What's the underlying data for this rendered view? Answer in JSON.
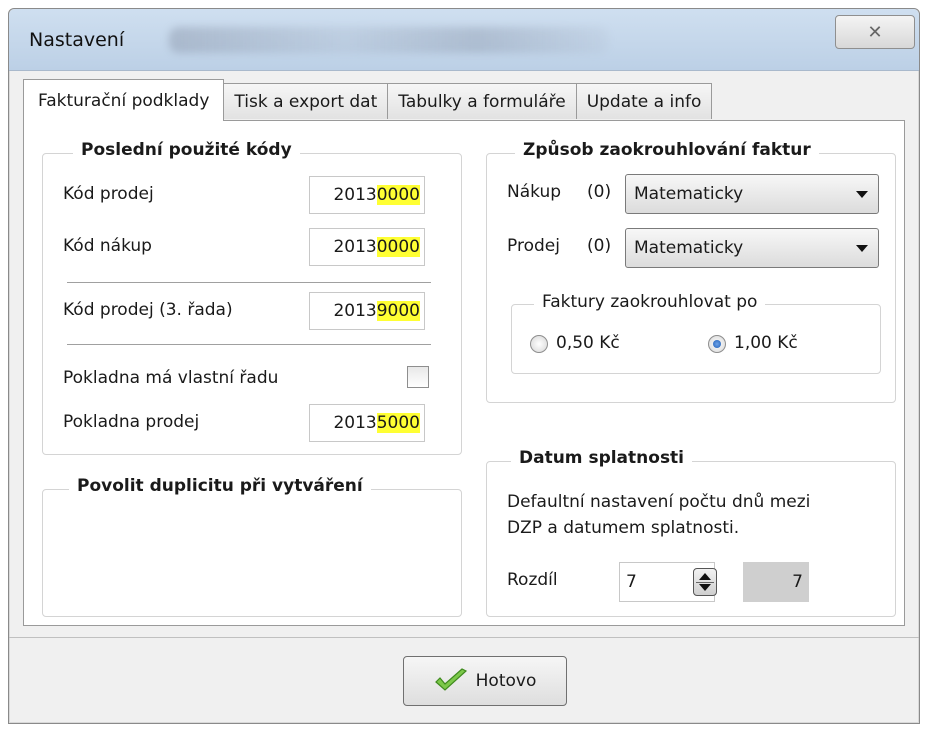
{
  "window": {
    "title": "Nastavení",
    "close_glyph": "✕"
  },
  "tabs": [
    {
      "label": "Fakturační podklady",
      "active": true
    },
    {
      "label": "Tisk a export dat",
      "active": false
    },
    {
      "label": "Tabulky a formuláře",
      "active": false
    },
    {
      "label": "Update a info",
      "active": false
    }
  ],
  "codes_group": {
    "title": "Poslední použité kódy",
    "rows": [
      {
        "label": "Kód prodej",
        "prefix": "2013",
        "highlight": "0000"
      },
      {
        "label": "Kód nákup",
        "prefix": "2013",
        "highlight": "0000"
      },
      {
        "label": "Kód prodej (3. řada)",
        "prefix": "2013",
        "highlight": "9000"
      }
    ],
    "pokladna_own_label": "Pokladna má vlastní řadu",
    "pokladna_own_checked": false,
    "pokladna_row": {
      "label": "Pokladna prodej",
      "prefix": "2013",
      "highlight": "5000"
    },
    "highlight_color": "#ffff33"
  },
  "duplicity_group": {
    "title": "Povolit duplicitu při vytváření"
  },
  "rounding_group": {
    "title": "Způsob zaokrouhlování faktur",
    "nakup": {
      "label": "Nákup",
      "code": "(0)",
      "value": "Matematicky"
    },
    "prodej": {
      "label": "Prodej",
      "code": "(0)",
      "value": "Matematicky"
    },
    "sub": {
      "title": "Faktury zaokrouhlovat po",
      "options": [
        {
          "label": "0,50 Kč",
          "checked": false
        },
        {
          "label": "1,00 Kč",
          "checked": true
        }
      ]
    }
  },
  "due_group": {
    "title": "Datum splatnosti",
    "description_line1": "Defaultní nastavení počtu dnů mezi",
    "description_line2": "DZP a datumem splatnosti.",
    "diff_label": "Rozdíl",
    "diff_value": "7",
    "computed_value": "7"
  },
  "footer": {
    "ok_label": "Hotovo"
  }
}
